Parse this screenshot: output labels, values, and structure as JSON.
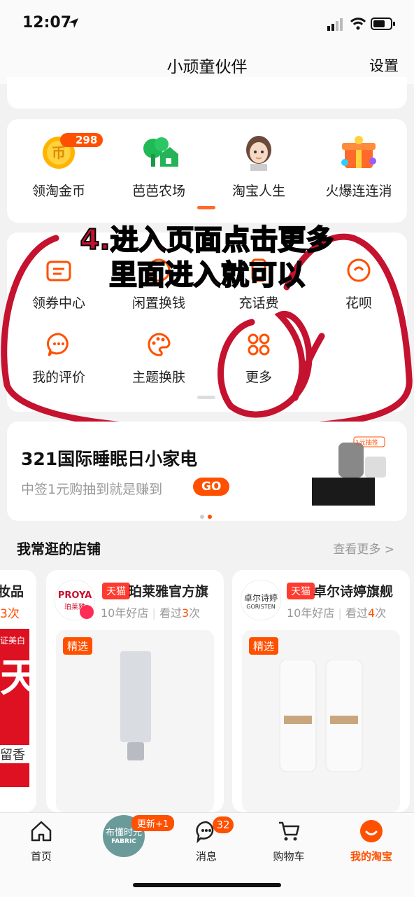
{
  "status": {
    "time": "12:07"
  },
  "nav": {
    "title": "小顽童伙伴",
    "settings": "设置"
  },
  "top_strip_text": "",
  "apps": [
    {
      "label": "领淘金币",
      "badge": "298"
    },
    {
      "label": "芭芭农场"
    },
    {
      "label": "淘宝人生"
    },
    {
      "label": "火爆连连消"
    }
  ],
  "tools": [
    {
      "label": "领券中心"
    },
    {
      "label": "闲置换钱"
    },
    {
      "label": "充话费"
    },
    {
      "label": "花呗"
    },
    {
      "label": "我的评价"
    },
    {
      "label": "主题换肤"
    },
    {
      "label": "更多"
    }
  ],
  "annotation": {
    "line1": "4.进入页面点击更多",
    "line2": "里面进入就可以"
  },
  "promo": {
    "title": "321国际睡眠日小家电",
    "subtitle": "中签1元购抽到就是赚到",
    "go": "GO",
    "badge": "1元抽签"
  },
  "shops_section": {
    "title": "我常逛的店铺",
    "more": "查看更多 >"
  },
  "shops": [
    {
      "left_partial_name": "妆品",
      "left_partial_visits": "3次"
    },
    {
      "tag": "天猫",
      "name": "珀莱雅官方旗",
      "logo": "PROYA",
      "logo_sub": "珀莱雅",
      "years": "10年好店",
      "visited": "看过",
      "visits": "3",
      "visits_suffix": "次",
      "pick": "精选"
    },
    {
      "tag": "天猫",
      "name": "卓尔诗婷旗舰",
      "logo": "卓尔诗婷",
      "logo_sub": "GORISTEN",
      "years": "10年好店",
      "visited": "看过",
      "visits": "4",
      "visits_suffix": "次",
      "pick": "精选"
    }
  ],
  "left_partial_ad": {
    "line1": "证美白",
    "line2": "天",
    "line3": "留香"
  },
  "tabs": [
    {
      "label": "首页"
    },
    {
      "label": "",
      "badge": "更新+1",
      "avatar_text": "布懂时光",
      "avatar_sub": "FABRIC"
    },
    {
      "label": "消息",
      "badge": "32"
    },
    {
      "label": "购物车"
    },
    {
      "label": "我的淘宝"
    }
  ],
  "colors": {
    "accent": "#ff5000",
    "annotation": "#c4122f",
    "tmall": "#ff3b2f"
  }
}
